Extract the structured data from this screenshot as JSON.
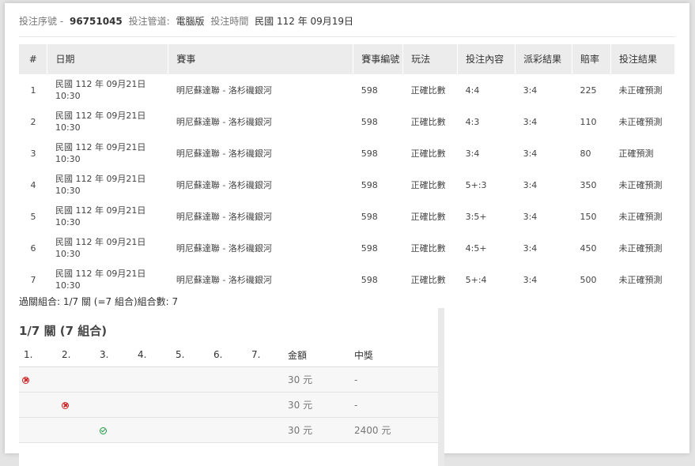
{
  "header": {
    "serial_label": "投注序號 -",
    "serial_value": "96751045",
    "channel_label": "投注管道:",
    "channel_value": "電腦版",
    "time_label": "投注時間",
    "time_value": "民國 112 年 09月19日"
  },
  "bets_table": {
    "columns": [
      "#",
      "日期",
      "賽事",
      "賽事編號",
      "玩法",
      "投注內容",
      "派彩結果",
      "賠率",
      "投注結果"
    ],
    "rows": [
      {
        "idx": "1",
        "date": "民國 112 年 09月21日",
        "time": "10:30",
        "match": "明尼蘇達聯 - 洛杉磯銀河",
        "match_no": "598",
        "play": "正確比數",
        "content": "4:4",
        "payout": "3:4",
        "odds": "225",
        "result": "未正確預測"
      },
      {
        "idx": "2",
        "date": "民國 112 年 09月21日",
        "time": "10:30",
        "match": "明尼蘇達聯 - 洛杉磯銀河",
        "match_no": "598",
        "play": "正確比數",
        "content": "4:3",
        "payout": "3:4",
        "odds": "110",
        "result": "未正確預測"
      },
      {
        "idx": "3",
        "date": "民國 112 年 09月21日",
        "time": "10:30",
        "match": "明尼蘇達聯 - 洛杉磯銀河",
        "match_no": "598",
        "play": "正確比數",
        "content": "3:4",
        "payout": "3:4",
        "odds": "80",
        "result": "正確預測"
      },
      {
        "idx": "4",
        "date": "民國 112 年 09月21日",
        "time": "10:30",
        "match": "明尼蘇達聯 - 洛杉磯銀河",
        "match_no": "598",
        "play": "正確比數",
        "content": "5+:3",
        "payout": "3:4",
        "odds": "350",
        "result": "未正確預測"
      },
      {
        "idx": "5",
        "date": "民國 112 年 09月21日",
        "time": "10:30",
        "match": "明尼蘇達聯 - 洛杉磯銀河",
        "match_no": "598",
        "play": "正確比數",
        "content": "3:5+",
        "payout": "3:4",
        "odds": "150",
        "result": "未正確預測"
      },
      {
        "idx": "6",
        "date": "民國 112 年 09月21日",
        "time": "10:30",
        "match": "明尼蘇達聯 - 洛杉磯銀河",
        "match_no": "598",
        "play": "正確比數",
        "content": "4:5+",
        "payout": "3:4",
        "odds": "450",
        "result": "未正確預測"
      },
      {
        "idx": "7",
        "date": "民國 112 年 09月21日",
        "time": "10:30",
        "match": "明尼蘇達聯 - 洛杉磯銀河",
        "match_no": "598",
        "play": "正確比數",
        "content": "5+:4",
        "payout": "3:4",
        "odds": "500",
        "result": "未正確預測"
      }
    ]
  },
  "combo_note": "過關組合: 1/7 關 (=7 組合)組合數: 7",
  "combo_section": {
    "title": "1/7 關 (7 組合)",
    "columns": [
      "1.",
      "2.",
      "3.",
      "4.",
      "5.",
      "6.",
      "7.",
      "金額",
      "中獎"
    ],
    "rows": [
      {
        "marks": [
          "x",
          "",
          "",
          "",
          "",
          "",
          ""
        ],
        "amount": "30 元",
        "prize": "-"
      },
      {
        "marks": [
          "",
          "x",
          "",
          "",
          "",
          "",
          ""
        ],
        "amount": "30 元",
        "prize": "-"
      },
      {
        "marks": [
          "",
          "",
          "ok",
          "",
          "",
          "",
          ""
        ],
        "amount": "30 元",
        "prize": "2400 元"
      }
    ],
    "mark_icons": {
      "x": "cross-circle-icon",
      "ok": "check-circle-icon"
    },
    "colors": {
      "x": "#cc2222",
      "ok": "#229944"
    }
  }
}
